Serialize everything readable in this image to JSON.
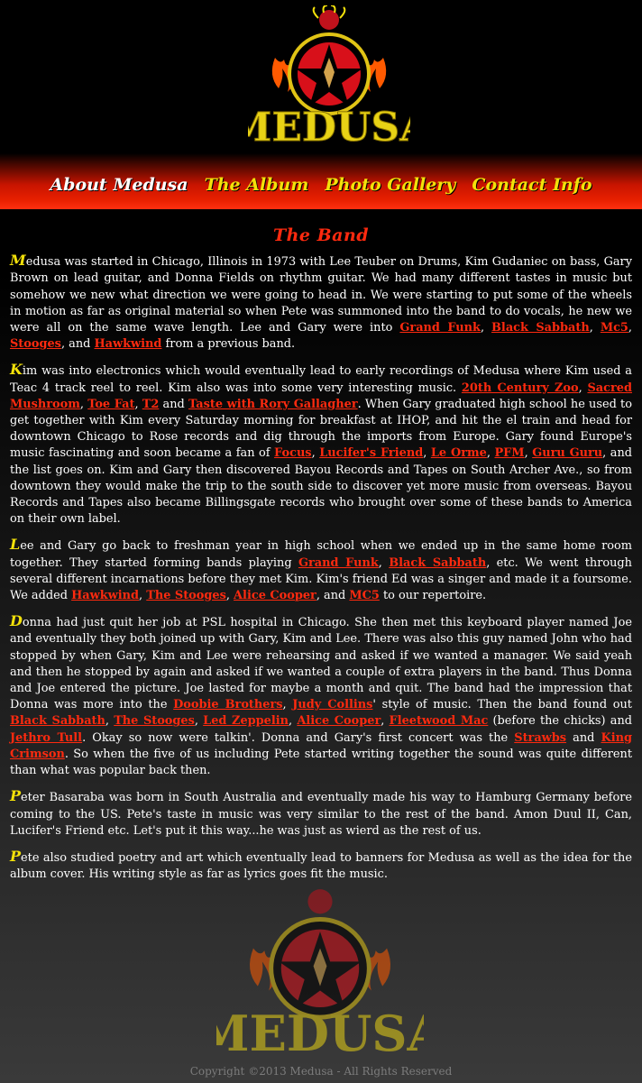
{
  "brand": {
    "logo_text": "MEDUSA"
  },
  "nav": [
    {
      "label": "About Medusa",
      "active": true
    },
    {
      "label": "The Album",
      "active": false
    },
    {
      "label": "Photo Gallery",
      "active": false
    },
    {
      "label": "Contact Info",
      "active": false
    }
  ],
  "page_title": "The Band",
  "paragraphs": [
    [
      {
        "t": "M",
        "drop": true
      },
      {
        "t": "edusa was started in Chicago, Illinois in 1973 with Lee Teuber on Drums, Kim Gudaniec on bass, Gary Brown on lead guitar, and Donna Fields on rhythm guitar. We had many different tastes in music but somehow we new what direction we were going to head in. We were starting to put some of the wheels in motion as far as original material so when Pete was summoned into the band to do vocals, he new we were all on the same wave length. Lee and Gary were into "
      },
      {
        "t": "Grand Funk",
        "link": true
      },
      {
        "t": ", "
      },
      {
        "t": "Black Sabbath",
        "link": true
      },
      {
        "t": ", "
      },
      {
        "t": "Mc5",
        "link": true
      },
      {
        "t": ", "
      },
      {
        "t": "Stooges",
        "link": true
      },
      {
        "t": ", and "
      },
      {
        "t": "Hawkwind",
        "link": true
      },
      {
        "t": " from a previous band."
      }
    ],
    [
      {
        "t": "K",
        "drop": true
      },
      {
        "t": "im was into electronics which would eventually lead to early recordings of Medusa where Kim used a Teac 4 track reel to reel. Kim also was into some very interesting music. "
      },
      {
        "t": "20th Century Zoo",
        "link": true
      },
      {
        "t": ", "
      },
      {
        "t": "Sacred Mushroom",
        "link": true
      },
      {
        "t": ", "
      },
      {
        "t": "Toe Fat",
        "link": true
      },
      {
        "t": ", "
      },
      {
        "t": "T2",
        "link": true
      },
      {
        "t": " and "
      },
      {
        "t": "Taste with Rory Gallagher",
        "link": true
      },
      {
        "t": ". When Gary graduated high school he used to get together with Kim every Saturday morning for breakfast at IHOP, and hit the el train and head for downtown Chicago to Rose records and dig through the imports from Europe. Gary found Europe's music fascinating and soon became a fan of "
      },
      {
        "t": "Focus",
        "link": true
      },
      {
        "t": ", "
      },
      {
        "t": "Lucifer's Friend",
        "link": true
      },
      {
        "t": ", "
      },
      {
        "t": "Le Orme",
        "link": true
      },
      {
        "t": ", "
      },
      {
        "t": "PFM",
        "link": true
      },
      {
        "t": ", "
      },
      {
        "t": "Guru Guru",
        "link": true
      },
      {
        "t": ", and the list goes on. Kim and Gary then discovered Bayou Records and Tapes on South Archer Ave., so from downtown they would make the trip to the south side to discover yet more music from overseas. Bayou Records and Tapes also became Billingsgate records who brought over some of these bands to America on their own label."
      }
    ],
    [
      {
        "t": "L",
        "drop": true
      },
      {
        "t": "ee and Gary go back to freshman year in high school when we ended up in the same home room together. They started forming bands playing "
      },
      {
        "t": "Grand Funk",
        "link": true
      },
      {
        "t": ", "
      },
      {
        "t": "Black Sabbath",
        "link": true
      },
      {
        "t": ", etc. We went through several different incarnations before they met Kim. Kim's friend Ed was a singer and made it a foursome. We added "
      },
      {
        "t": "Hawkwind",
        "link": true
      },
      {
        "t": ", "
      },
      {
        "t": "The Stooges",
        "link": true
      },
      {
        "t": ", "
      },
      {
        "t": "Alice Cooper",
        "link": true
      },
      {
        "t": ", and "
      },
      {
        "t": "MC5",
        "link": true
      },
      {
        "t": " to our repertoire."
      }
    ],
    [
      {
        "t": "D",
        "drop": true
      },
      {
        "t": "onna had just quit her job at PSL hospital in Chicago. She then met this keyboard player named Joe and eventually they both joined up with Gary, Kim and Lee. There was also this guy named John who had stopped by when Gary, Kim and Lee were rehearsing and asked if we wanted a manager. We said yeah and then he stopped by again and asked if we wanted a couple of extra players in the band. Thus Donna and Joe entered the picture. Joe lasted for maybe a month and quit. The band had the impression that Donna was more into the "
      },
      {
        "t": "Doobie Brothers",
        "link": true
      },
      {
        "t": ", "
      },
      {
        "t": "Judy Collins",
        "link": true
      },
      {
        "t": "' style of music. Then the band found out "
      },
      {
        "t": "Black Sabbath",
        "link": true
      },
      {
        "t": ", "
      },
      {
        "t": "The Stooges",
        "link": true
      },
      {
        "t": ", "
      },
      {
        "t": "Led Zeppelin",
        "link": true
      },
      {
        "t": ", "
      },
      {
        "t": "Alice Cooper",
        "link": true
      },
      {
        "t": ", "
      },
      {
        "t": "Fleetwood Mac",
        "link": true
      },
      {
        "t": " (before the chicks) and "
      },
      {
        "t": "Jethro Tull",
        "link": true
      },
      {
        "t": ". Okay so now were talkin'. Donna and Gary's first concert was the "
      },
      {
        "t": "Strawbs",
        "link": true
      },
      {
        "t": " and "
      },
      {
        "t": "King Crimson",
        "link": true
      },
      {
        "t": ". So when the five of us including Pete started writing together the sound was quite different than what was popular back then."
      }
    ],
    [
      {
        "t": "P",
        "drop": true
      },
      {
        "t": "eter Basaraba was born in South Australia and eventually made his way to Hamburg Germany before coming to the US. Pete's taste in music was very similar to the rest of the band. Amon Duul II, Can, Lucifer's Friend etc. Let's put it this way...he was just as wierd as the rest of us."
      }
    ],
    [
      {
        "t": "P",
        "drop": true
      },
      {
        "t": "ete also studied poetry and art which eventually lead to banners for Medusa as well as the idea for the album cover. His writing style as far as lyrics goes fit the music."
      }
    ]
  ],
  "footer": {
    "copyright": "Copyright ©2013 Medusa - All Rights Reserved"
  },
  "colors": {
    "link": "#ff2a0f",
    "nav": "#f3e10a",
    "accent": "#c81400"
  }
}
